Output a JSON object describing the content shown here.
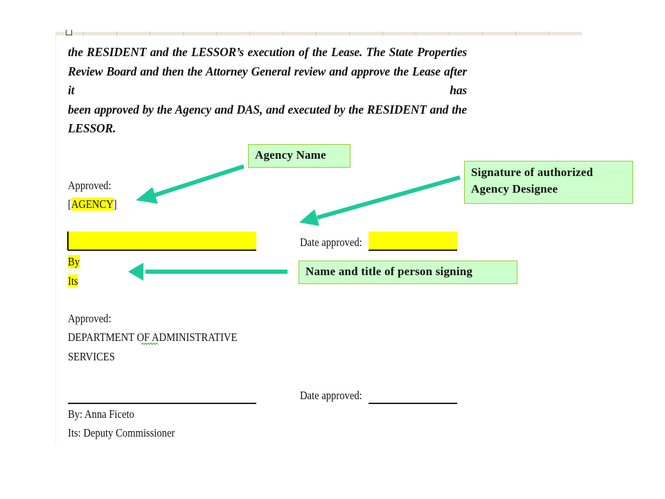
{
  "document": {
    "paragraph_lines": [
      "the RESIDENT and the LESSOR’s execution of the Lease.  The State Properties",
      "Review Board and then the Attorney General review and approve the Lease after it has",
      "been approved by the Agency and DAS, and executed by the RESIDENT and the",
      "LESSOR."
    ],
    "agency_block": {
      "approved_label": "Approved:",
      "agency_open_bracket": "[",
      "agency_placeholder": "AGENCY",
      "agency_close_bracket": "]",
      "by_label": "By",
      "its_label": "Its",
      "date_label": "Date approved:"
    },
    "das_block": {
      "approved_label": "Approved:",
      "dept_line1_part1": "DEPARTMENT ",
      "dept_line1_of": "OF",
      "dept_line1_part2": " ADMINISTRATIVE",
      "dept_line2": "SERVICES",
      "date_label": "Date approved:",
      "by_line": "By:  Anna Ficeto",
      "its_line": "Its:   Deputy Commissioner"
    }
  },
  "callouts": {
    "agency_name": "Agency Name",
    "signature_line1": "Signature of authorized",
    "signature_line2": "Agency Designee",
    "name_title": "Name and title of person signing"
  },
  "colors": {
    "highlight": "#ffff00",
    "callout_bg": "#ccffcc",
    "callout_border": "#99cc33",
    "arrow": "#1dc99a"
  }
}
